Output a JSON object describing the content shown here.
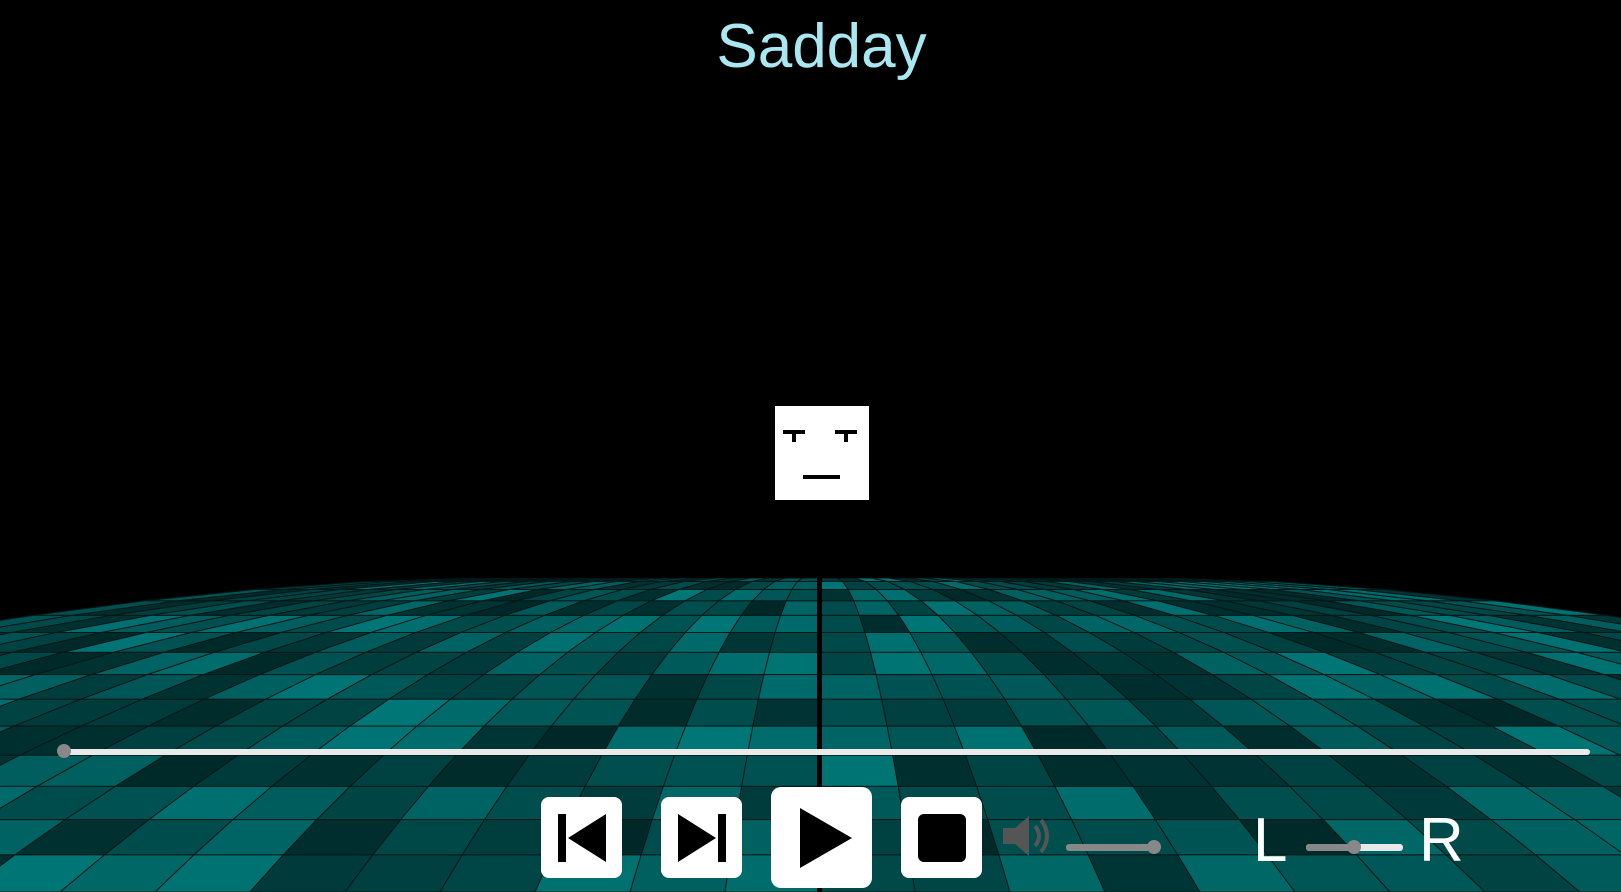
{
  "track": {
    "title": "Sadday"
  },
  "seek": {
    "progress": 0.0
  },
  "controls": {
    "prev_icon": "skip-previous-icon",
    "next_icon": "skip-next-icon",
    "play_icon": "play-icon",
    "stop_icon": "stop-icon",
    "volume_icon": "speaker-volume-icon"
  },
  "volume": {
    "level": 1.0
  },
  "balance": {
    "left_label": "L",
    "right_label": "R",
    "value": 0.0
  },
  "colors": {
    "title": "#a8e8f0",
    "floor_tile": "#0f6e6e",
    "background": "#000000"
  }
}
